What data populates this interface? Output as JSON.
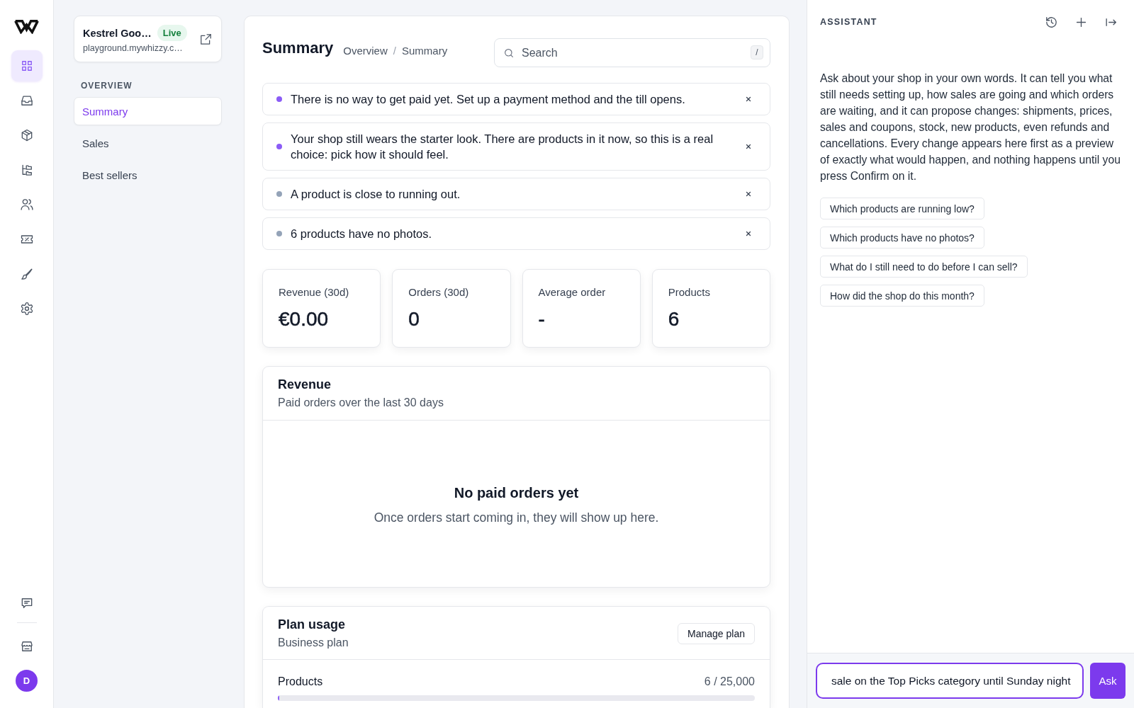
{
  "rail": {
    "nav": [
      {
        "kind": "grid",
        "selected": true
      },
      {
        "kind": "tray",
        "selected": false
      },
      {
        "kind": "cube",
        "selected": false
      },
      {
        "kind": "tree",
        "selected": false
      },
      {
        "kind": "people",
        "selected": false
      },
      {
        "kind": "ticket",
        "selected": false
      },
      {
        "kind": "brush",
        "selected": false
      },
      {
        "kind": "gear",
        "selected": false
      }
    ],
    "avatar": "D"
  },
  "sidebar": {
    "shop": {
      "name": "Kestrel Goo…",
      "status": "Live",
      "url": "playground.mywhizzy.c…"
    },
    "section": "OVERVIEW",
    "nav": [
      {
        "label": "Summary",
        "selected": true
      },
      {
        "label": "Sales",
        "selected": false
      },
      {
        "label": "Best sellers",
        "selected": false
      }
    ]
  },
  "main": {
    "title": "Summary",
    "breadcrumb": [
      "Overview",
      "Summary"
    ],
    "breadcrumb_separator": "/",
    "search": {
      "placeholder": "Search",
      "shortcut": "/"
    },
    "alerts": [
      {
        "text": "There is no way to get paid yet. Set up a payment method and the till opens.",
        "color": "#8b5cf6"
      },
      {
        "text": "Your shop still wears the starter look. There are products in it now, so this is a real choice: pick how it should feel.",
        "color": "#8b5cf6"
      },
      {
        "text": "A product is close to running out.",
        "color": "#94a3b8"
      },
      {
        "text": "6 products have no photos.",
        "color": "#94a3b8"
      }
    ],
    "stats": [
      {
        "label": "Revenue (30d)",
        "value": "€0.00"
      },
      {
        "label": "Orders (30d)",
        "value": "0"
      },
      {
        "label": "Average order",
        "value": "-"
      },
      {
        "label": "Products",
        "value": "6"
      }
    ],
    "revenue": {
      "title": "Revenue",
      "subtitle": "Paid orders over the last 30 days",
      "empty_title": "No paid orders yet",
      "empty_text": "Once orders start coming in, they will show up here."
    },
    "plan": {
      "title": "Plan usage",
      "subtitle": "Business plan",
      "button": "Manage plan",
      "usage": [
        {
          "label": "Products",
          "reading": "6 / 25,000",
          "level": 0.00024
        }
      ]
    }
  },
  "assistant": {
    "title": "ASSISTANT",
    "intro": "Ask about your shop in your own words. It can tell you what still needs setting up, how sales are going and which orders are waiting, and it can propose changes: shipments, prices, sales and coupons, stock, new products, even refunds and cancellations. Every change appears here first as a preview of exactly what would happen, and nothing happens until you press Confirm on it.",
    "suggestions": [
      "Which products are running low?",
      "Which products have no photos?",
      "What do I still need to do before I can sell?",
      "How did the shop do this month?"
    ],
    "input": {
      "value": "sale on the Top Picks category until Sunday night",
      "focused": true
    },
    "submit": "Ask"
  }
}
